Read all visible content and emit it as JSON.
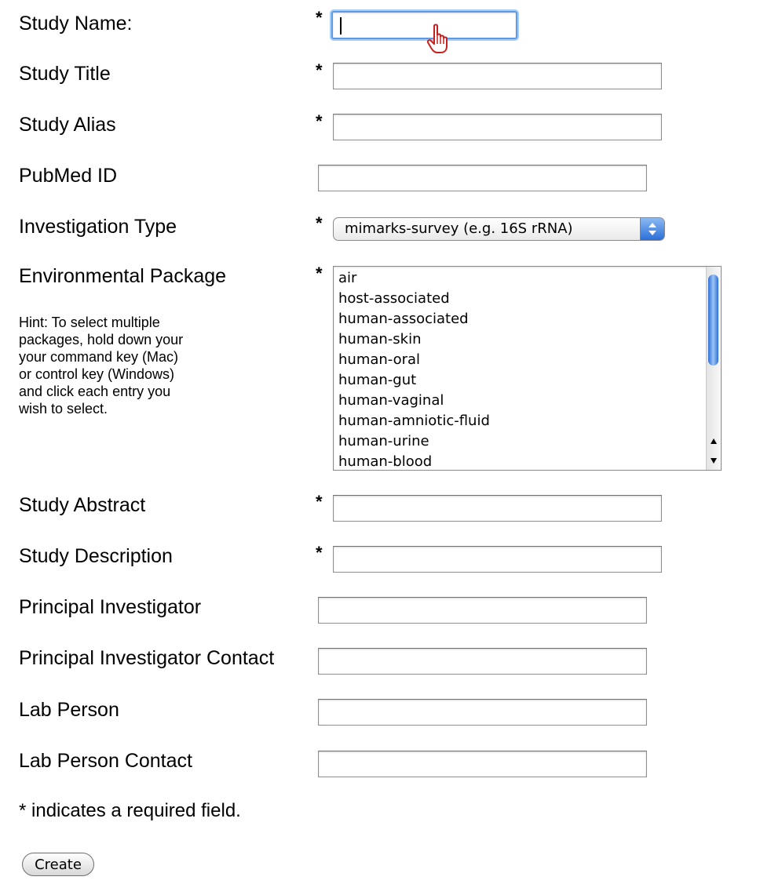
{
  "form": {
    "labels": {
      "study_name": "Study Name:",
      "study_title": "Study Title",
      "study_alias": "Study Alias",
      "pubmed_id": "PubMed ID",
      "investigation_type": "Investigation Type",
      "environmental_package": "Environmental Package",
      "study_abstract": "Study Abstract",
      "study_description": "Study Description",
      "principal_investigator": "Principal Investigator",
      "principal_investigator_contact": "Principal Investigator Contact",
      "lab_person": "Lab Person",
      "lab_person_contact": "Lab Person Contact"
    },
    "required_marker": "*",
    "values": {
      "study_name": "",
      "study_title": "",
      "study_alias": "",
      "pubmed_id": "",
      "study_abstract": "",
      "study_description": "",
      "principal_investigator": "",
      "principal_investigator_contact": "",
      "lab_person": "",
      "lab_person_contact": ""
    },
    "investigation_type_selected": "mimarks-survey (e.g. 16S rRNA)",
    "environmental_package_options": [
      "air",
      "host-associated",
      "human-associated",
      "human-skin",
      "human-oral",
      "human-gut",
      "human-vaginal",
      "human-amniotic-fluid",
      "human-urine",
      "human-blood"
    ],
    "hint_lines": [
      "Hint: To select multiple",
      "packages, hold down your",
      "your command key (Mac)",
      "or control key (Windows)",
      "and click each entry you",
      "wish to select."
    ],
    "footnote": "* indicates a required field.",
    "create_button": "Create"
  },
  "icons": {
    "cursor": "hand-pointer-icon",
    "select_arrows": "up-down-arrows-icon",
    "scroll_up": "scroll-up-arrow-icon",
    "scroll_down": "scroll-down-arrow-icon"
  },
  "colors": {
    "focus_ring": "#5b9be8",
    "select_arrow_blue": "#2a6fd8",
    "scroll_thumb": "#2f6fd4",
    "cursor_red": "#c8201e"
  }
}
